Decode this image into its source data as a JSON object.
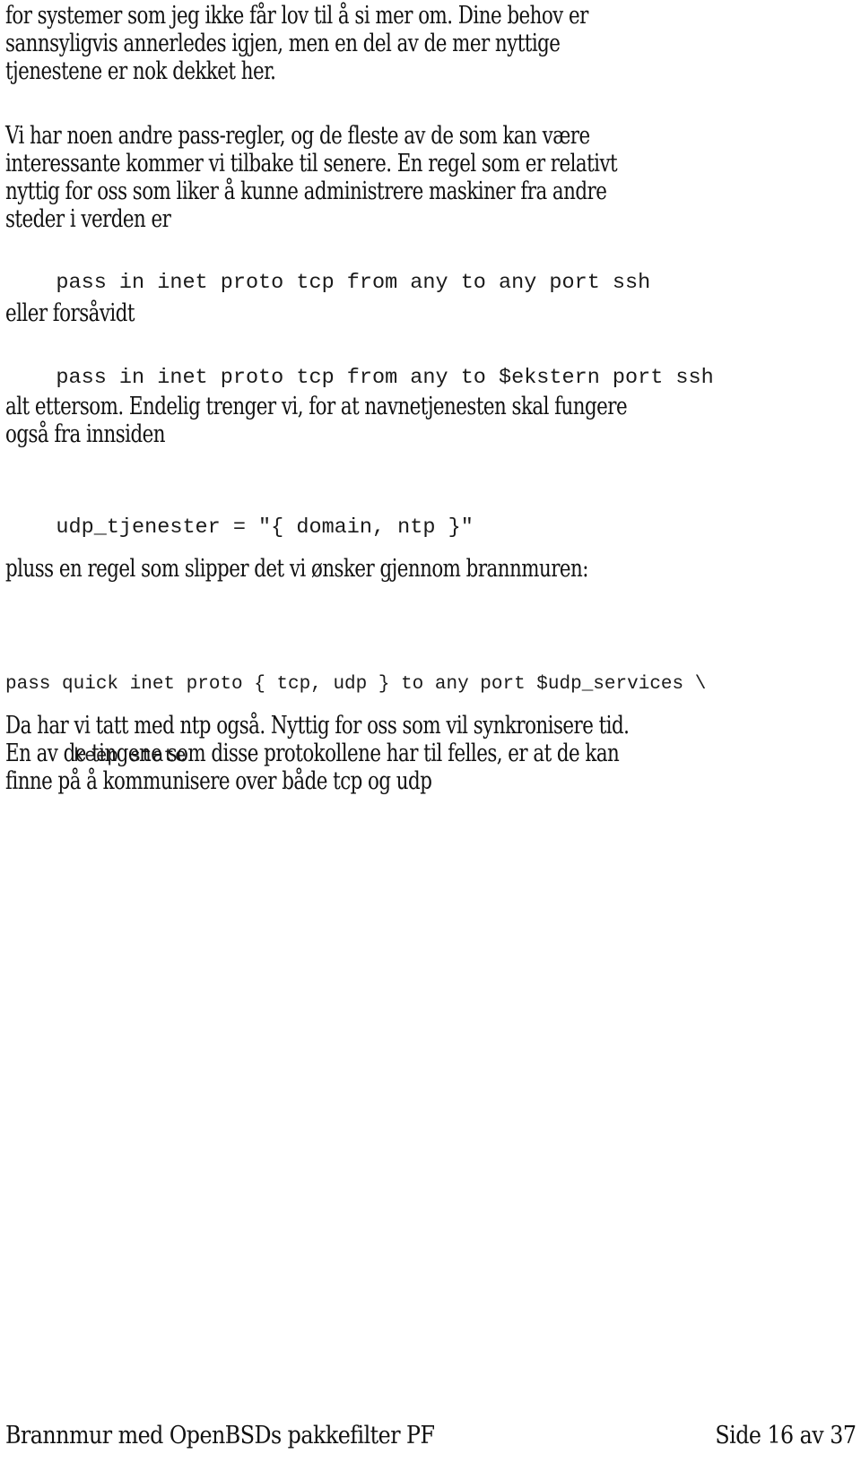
{
  "document": {
    "paragraphs": [
      {
        "lines": [
          "for systemer som jeg ikke får lov til å si mer om.  Dine behov er",
          "sannsyligvis annerledes igjen, men en del av de mer nyttige",
          "tjenestene er nok dekket her."
        ]
      },
      {
        "lines": [
          "Vi har noen andre pass-regler, og de fleste av de som kan være",
          "interessante kommer vi tilbake til senere.  En regel som er relativt",
          "nyttig for oss som liker å kunne administrere maskiner fra andre",
          "steder i verden er"
        ]
      },
      {
        "lines": [
          "eller forsåvidt"
        ]
      },
      {
        "lines": [
          "alt ettersom.  Endelig trenger vi, for at navnetjenesten skal fungere",
          "også fra innsiden"
        ]
      },
      {
        "lines": [
          "pluss en regel som slipper det vi ønsker gjennom brannmuren:"
        ]
      },
      {
        "lines": [
          "Da har vi tatt med ntp også.  Nyttig for oss som vil synkronisere tid.",
          "En av de tingene som disse protokollene har til felles, er at de kan",
          "finne på å kommunisere over både tcp og udp"
        ]
      }
    ],
    "code_blocks": [
      {
        "lines": [
          "pass in inet proto tcp from any to any port ssh"
        ]
      },
      {
        "lines": [
          "pass in inet proto tcp from any to $ekstern port ssh"
        ]
      },
      {
        "lines": [
          "udp_tjenester = \"{ domain, ntp }\""
        ]
      },
      {
        "lines": [
          "pass quick inet proto { tcp, udp } to any port $udp_services \\",
          "      keep state"
        ]
      }
    ]
  },
  "footer": {
    "title": "Brannmur med OpenBSDs pakkefilter PF",
    "page_label": "Side 16 av 37"
  }
}
